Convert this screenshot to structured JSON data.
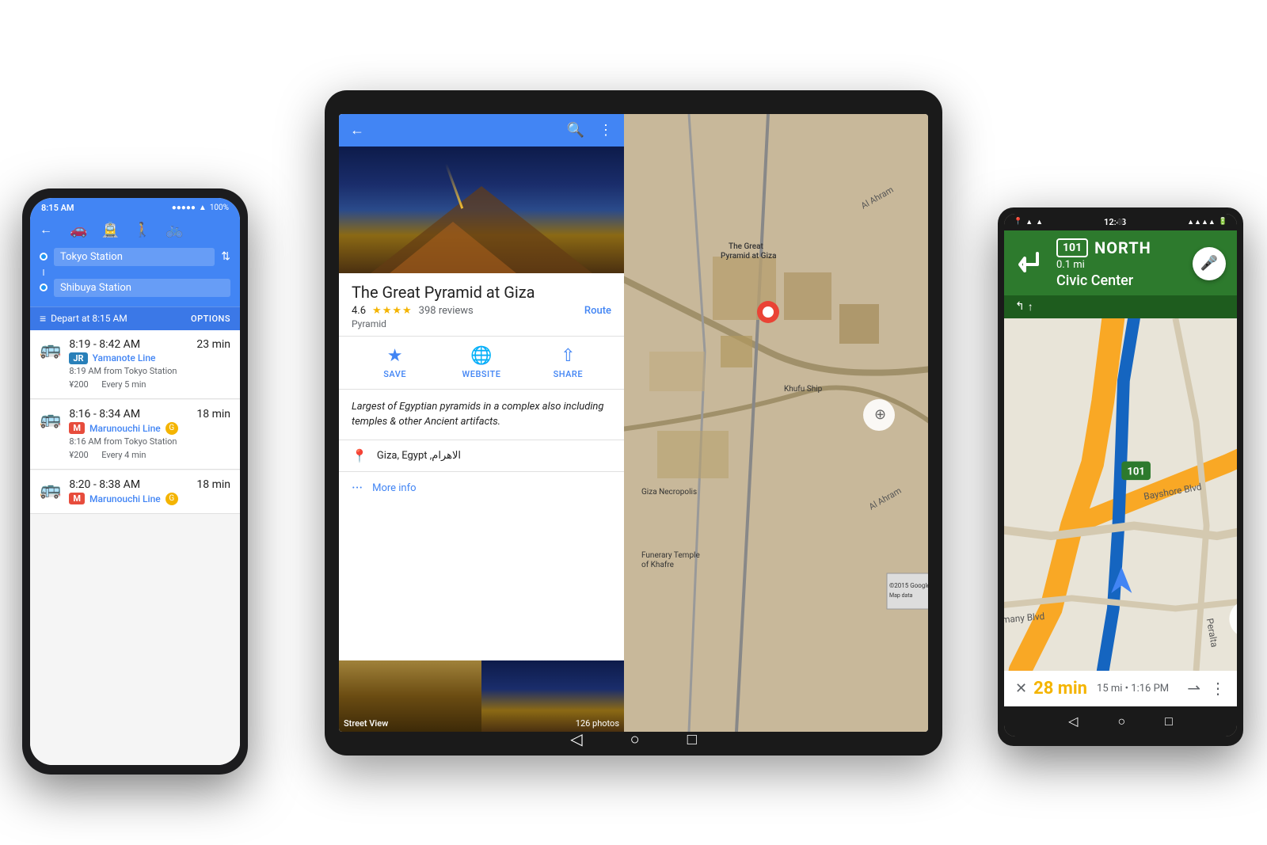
{
  "scene": {
    "background": "#ffffff"
  },
  "tablet": {
    "place_name": "The Great Pyramid at Giza",
    "rating": "4.6",
    "stars": "★★★★",
    "reviews": "398 reviews",
    "route_btn": "Route",
    "place_type": "Pyramid",
    "action_save": "SAVE",
    "action_website": "WEBSITE",
    "action_share": "SHARE",
    "description": "Largest of Egyptian pyramids in a complex also including temples & other Ancient artifacts.",
    "address": "Giza, Egypt ,الاهرام",
    "more_info": "More info",
    "street_view": "Street View",
    "photos_count": "126 photos",
    "map_labels": {
      "great_pyramid": "The Great Pyramid at Giza",
      "khufu": "Khufu Ship",
      "giza_necropolis": "Giza Necropolis",
      "funerary": "Funerary Temple of Khafre"
    }
  },
  "iphone": {
    "time": "8:15 AM",
    "battery": "100%",
    "from_station": "Tokyo Station",
    "to_station": "Shibuya Station",
    "depart": "Depart at 8:15 AM",
    "options": "OPTIONS",
    "routes": [
      {
        "time_range": "8:19 - 8:42 AM",
        "duration": "23 min",
        "line_type": "JR",
        "line_name": "Yamanote Line",
        "from_time": "8:19 AM from Tokyo Station",
        "price": "¥200",
        "frequency": "Every 5 min"
      },
      {
        "time_range": "8:16 - 8:34 AM",
        "duration": "18 min",
        "line_type": "M",
        "line_name": "Marunouchi Line",
        "badge2": "G",
        "from_time": "8:16 AM from Tokyo Station",
        "price": "¥200",
        "frequency": "Every 4 min"
      },
      {
        "time_range": "8:20 - 8:38 AM",
        "duration": "18 min",
        "line_type": "M",
        "line_name": "Marunouchi Line",
        "badge2": "G",
        "from_time": "",
        "price": "",
        "frequency": ""
      }
    ]
  },
  "android": {
    "time": "12:48",
    "highway": "101",
    "direction": "NORTH",
    "destination": "Civic Center",
    "distance": "0.1 mi",
    "eta": "28 min",
    "miles": "15 mi",
    "arrival": "1:16 PM",
    "map_labels": {
      "bayshore": "Bayshore Blvd",
      "alemany": "Alemany Blvd",
      "peralta": "Peralta"
    }
  }
}
